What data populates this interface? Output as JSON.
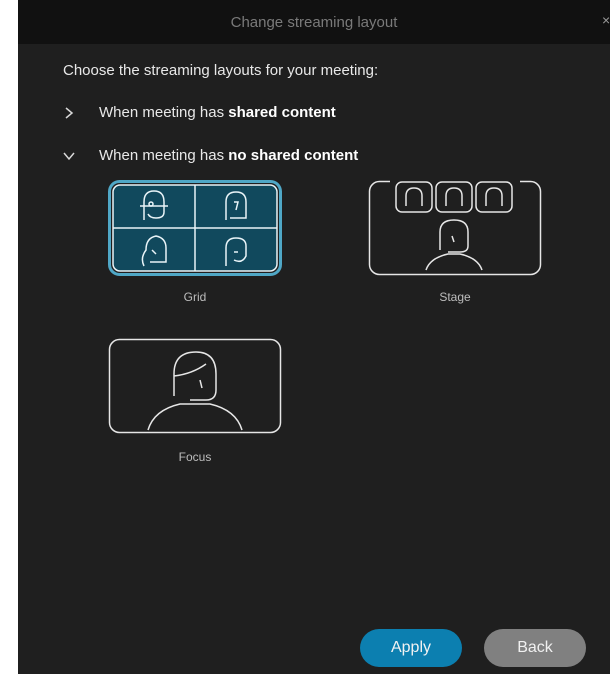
{
  "dialog": {
    "title": "Change streaming layout",
    "close_glyph": "×",
    "intro": "Choose the streaming layouts for your meeting:"
  },
  "sections": [
    {
      "prefix": "When meeting has ",
      "bold": "shared content",
      "expanded": false,
      "icon": "chevron-right-icon"
    },
    {
      "prefix": "When meeting has ",
      "bold": "no shared content",
      "expanded": true,
      "icon": "chevron-down-icon"
    }
  ],
  "layouts": [
    {
      "label": "Grid",
      "selected": true
    },
    {
      "label": "Stage",
      "selected": false
    },
    {
      "label": "Focus",
      "selected": false
    }
  ],
  "buttons": {
    "apply": "Apply",
    "back": "Back"
  },
  "colors": {
    "dialog_bg": "#1f1f1f",
    "titlebar_bg": "#111111",
    "selected_fill": "#11495d",
    "selected_border": "#5bb6d6",
    "apply_bg": "#0c7fb0",
    "back_bg": "#808080"
  }
}
